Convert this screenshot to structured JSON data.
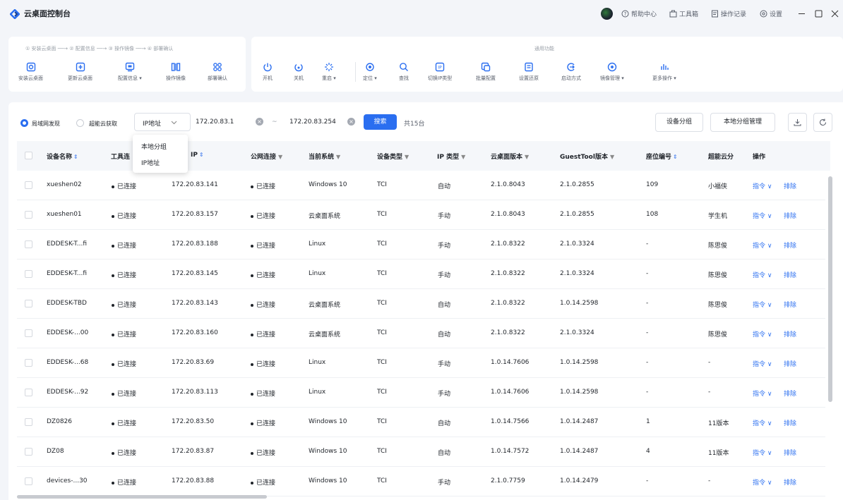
{
  "app": {
    "title": "云桌面控制台"
  },
  "titlebar": {
    "help": "帮助中心",
    "toolbox": "工具箱",
    "log": "操作记录",
    "settings": "设置"
  },
  "steps_breadcrumb": "① 安装云桌面 ──→ ② 配置信息 ──→ ③ 操作镜像 ──→ ④ 部署确认",
  "setup_tools": [
    {
      "label": "安装云桌面",
      "icon": "install-icon"
    },
    {
      "label": "更新云桌面",
      "icon": "update-icon"
    },
    {
      "label": "配置信息 ▾",
      "icon": "config-icon"
    },
    {
      "label": "操作镜像",
      "icon": "image-icon"
    },
    {
      "label": "部署确认",
      "icon": "deploy-icon"
    }
  ],
  "common_section_label": "通用功能",
  "common_tools": [
    {
      "label": "开机",
      "icon": "power-on-icon"
    },
    {
      "label": "关机",
      "icon": "power-off-icon"
    },
    {
      "label": "重启 ▾",
      "icon": "restart-icon"
    },
    {
      "label": "定位 ▾",
      "icon": "locate-icon"
    },
    {
      "label": "查找",
      "icon": "search-icon"
    },
    {
      "label": "切换IP类型",
      "icon": "switch-ip-icon"
    },
    {
      "label": "批量配置",
      "icon": "batch-config-icon"
    },
    {
      "label": "设置还原",
      "icon": "restore-icon"
    },
    {
      "label": "启动方式",
      "icon": "boot-mode-icon"
    },
    {
      "label": "镜像管理 ▾",
      "icon": "image-manage-icon"
    },
    {
      "label": "更多操作 ▾",
      "icon": "more-icon"
    }
  ],
  "filter": {
    "radio_lan": "局域网发现",
    "radio_cloud": "超能云获取",
    "select_value": "IP地址",
    "ip_from": "172.20.83.1",
    "ip_sep": "~",
    "ip_to": "172.20.83.254",
    "search_label": "搜索",
    "total": "共15台",
    "group_btn": "设备分组",
    "local_group_btn": "本地分组管理"
  },
  "dropdown": {
    "options": [
      "本地分组",
      "IP地址"
    ]
  },
  "columns": [
    "设备名称",
    "工具连",
    "IP",
    "公网连接",
    "当前系统",
    "设备类型",
    "IP 类型",
    "云桌面版本",
    "GuestTool版本",
    "座位编号",
    "超能云分",
    "操作"
  ],
  "row_actions": {
    "command": "指令 ∨",
    "remove": "排除"
  },
  "rows": [
    {
      "name": "xueshen02",
      "tool": "已连接",
      "ip": "172.20.83.141",
      "net": "已连接",
      "os": "Windows 10",
      "type": "TCI",
      "iptype": "自动",
      "ver": "2.1.0.8043",
      "gt": "2.1.0.2855",
      "seat": "109",
      "group": "小福侠"
    },
    {
      "name": "xueshen01",
      "tool": "已连接",
      "ip": "172.20.83.157",
      "net": "已连接",
      "os": "云桌面系统",
      "type": "TCI",
      "iptype": "手动",
      "ver": "2.1.0.8043",
      "gt": "2.1.0.2855",
      "seat": "108",
      "group": "学生机"
    },
    {
      "name": "EDDESK-T...fi",
      "tool": "已连接",
      "ip": "172.20.83.188",
      "net": "已连接",
      "os": "Linux",
      "type": "TCI",
      "iptype": "手动",
      "ver": "2.1.0.8322",
      "gt": "2.1.0.3324",
      "seat": "-",
      "group": "陈思俊"
    },
    {
      "name": "EDDESK-T...fi",
      "tool": "已连接",
      "ip": "172.20.83.145",
      "net": "已连接",
      "os": "Linux",
      "type": "TCI",
      "iptype": "手动",
      "ver": "2.1.0.8322",
      "gt": "2.1.0.3324",
      "seat": "-",
      "group": "陈思俊"
    },
    {
      "name": "EDDESK-TBD",
      "tool": "已连接",
      "ip": "172.20.83.143",
      "net": "已连接",
      "os": "云桌面系统",
      "type": "TCI",
      "iptype": "自动",
      "ver": "2.1.0.8322",
      "gt": "1.0.14.2598",
      "seat": "-",
      "group": "陈思俊"
    },
    {
      "name": "EDDESK-...00",
      "tool": "已连接",
      "ip": "172.20.83.160",
      "net": "已连接",
      "os": "云桌面系统",
      "type": "TCI",
      "iptype": "自动",
      "ver": "2.1.0.8322",
      "gt": "2.1.0.3324",
      "seat": "-",
      "group": "陈思俊"
    },
    {
      "name": "EDDESK-...68",
      "tool": "已连接",
      "ip": "172.20.83.69",
      "net": "已连接",
      "os": "Linux",
      "type": "TCI",
      "iptype": "手动",
      "ver": "1.0.14.7606",
      "gt": "1.0.14.2598",
      "seat": "-",
      "group": "-"
    },
    {
      "name": "EDDESK-...92",
      "tool": "已连接",
      "ip": "172.20.83.113",
      "net": "已连接",
      "os": "Linux",
      "type": "TCI",
      "iptype": "手动",
      "ver": "1.0.14.7606",
      "gt": "1.0.14.2598",
      "seat": "-",
      "group": "-"
    },
    {
      "name": "DZ0826",
      "tool": "已连接",
      "ip": "172.20.83.50",
      "net": "已连接",
      "os": "Windows 10",
      "type": "TCI",
      "iptype": "自动",
      "ver": "1.0.14.7566",
      "gt": "1.0.14.2487",
      "seat": "1",
      "group": "11版本"
    },
    {
      "name": "DZ08",
      "tool": "已连接",
      "ip": "172.20.83.87",
      "net": "已连接",
      "os": "Windows 10",
      "type": "TCI",
      "iptype": "自动",
      "ver": "1.0.14.7572",
      "gt": "1.0.14.2487",
      "seat": "4",
      "group": "11版本"
    },
    {
      "name": "devices-...30",
      "tool": "已连接",
      "ip": "172.20.83.88",
      "net": "已连接",
      "os": "Windows 10",
      "type": "TCI",
      "iptype": "手动",
      "ver": "2.1.0.7759",
      "gt": "1.0.14.2479",
      "seat": "-",
      "group": "-"
    }
  ]
}
